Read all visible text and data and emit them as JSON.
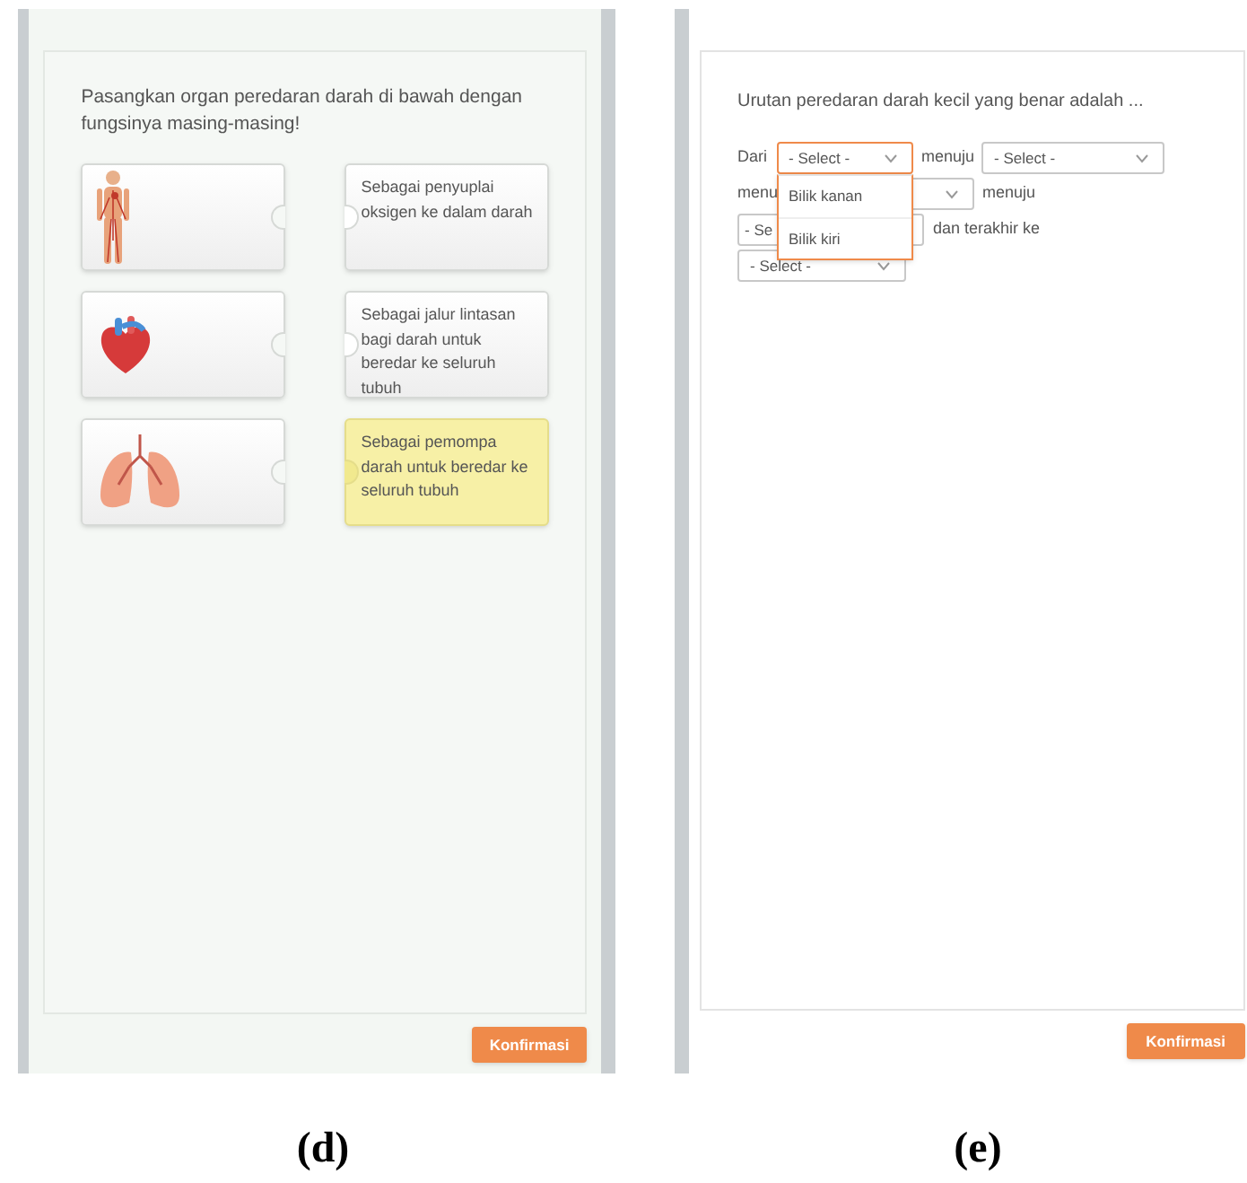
{
  "panels": [
    {
      "kind": "matching",
      "caption": "(d)",
      "question": "Pasangkan organ peredaran darah di bawah dengan fungsinya masing-masing!",
      "organs": [
        {
          "kind": "body"
        },
        {
          "kind": "heart"
        },
        {
          "kind": "lungs"
        }
      ],
      "answers": [
        {
          "text": "Sebagai penyuplai oksigen ke dalam darah",
          "selected": false
        },
        {
          "text": "Sebagai jalur lintasan bagi darah untuk beredar ke seluruh tubuh",
          "selected": false
        },
        {
          "text": "Sebagai pemompa darah untuk beredar ke seluruh tubuh",
          "selected": true
        }
      ],
      "button": "Konfirmasi"
    },
    {
      "kind": "fill",
      "caption": "(e)",
      "question": "Urutan peredaran darah kecil yang benar adalah ...",
      "parts": [
        {
          "kind": "label",
          "text": "Dari"
        },
        {
          "kind": "select",
          "value": "- Select -",
          "expanded": true,
          "options": [
            "Bilik kanan",
            "Bilik kiri"
          ]
        },
        {
          "kind": "label",
          "text": "menuju"
        },
        {
          "kind": "select",
          "value": "- Select -",
          "expanded": false
        },
        {
          "kind": "label",
          "text": "menu"
        },
        {
          "kind": "select",
          "expanded": false
        },
        {
          "kind": "label",
          "text": "menuju"
        },
        {
          "kind": "select",
          "value": "- Se",
          "expanded": false
        },
        {
          "kind": "label",
          "text": "dan terakhir ke"
        },
        {
          "kind": "select",
          "value": "- Select -",
          "expanded": false
        }
      ],
      "button": "Konfirmasi"
    }
  ]
}
